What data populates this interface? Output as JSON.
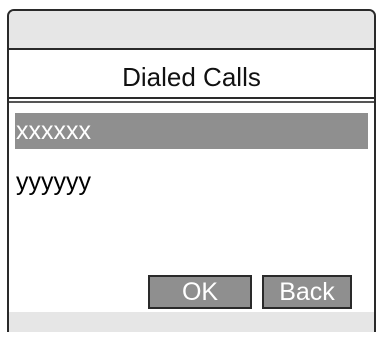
{
  "screen": {
    "title": "Dialed Calls"
  },
  "list": {
    "items": [
      {
        "label": "xxxxxx",
        "selected": true
      },
      {
        "label": "yyyyyy",
        "selected": false
      }
    ]
  },
  "softkeys": {
    "ok_label": "OK",
    "back_label": "Back"
  },
  "colors": {
    "highlight": "#8f8f8f",
    "bezel": "#e6e6e6",
    "border": "#2a2a2a"
  }
}
